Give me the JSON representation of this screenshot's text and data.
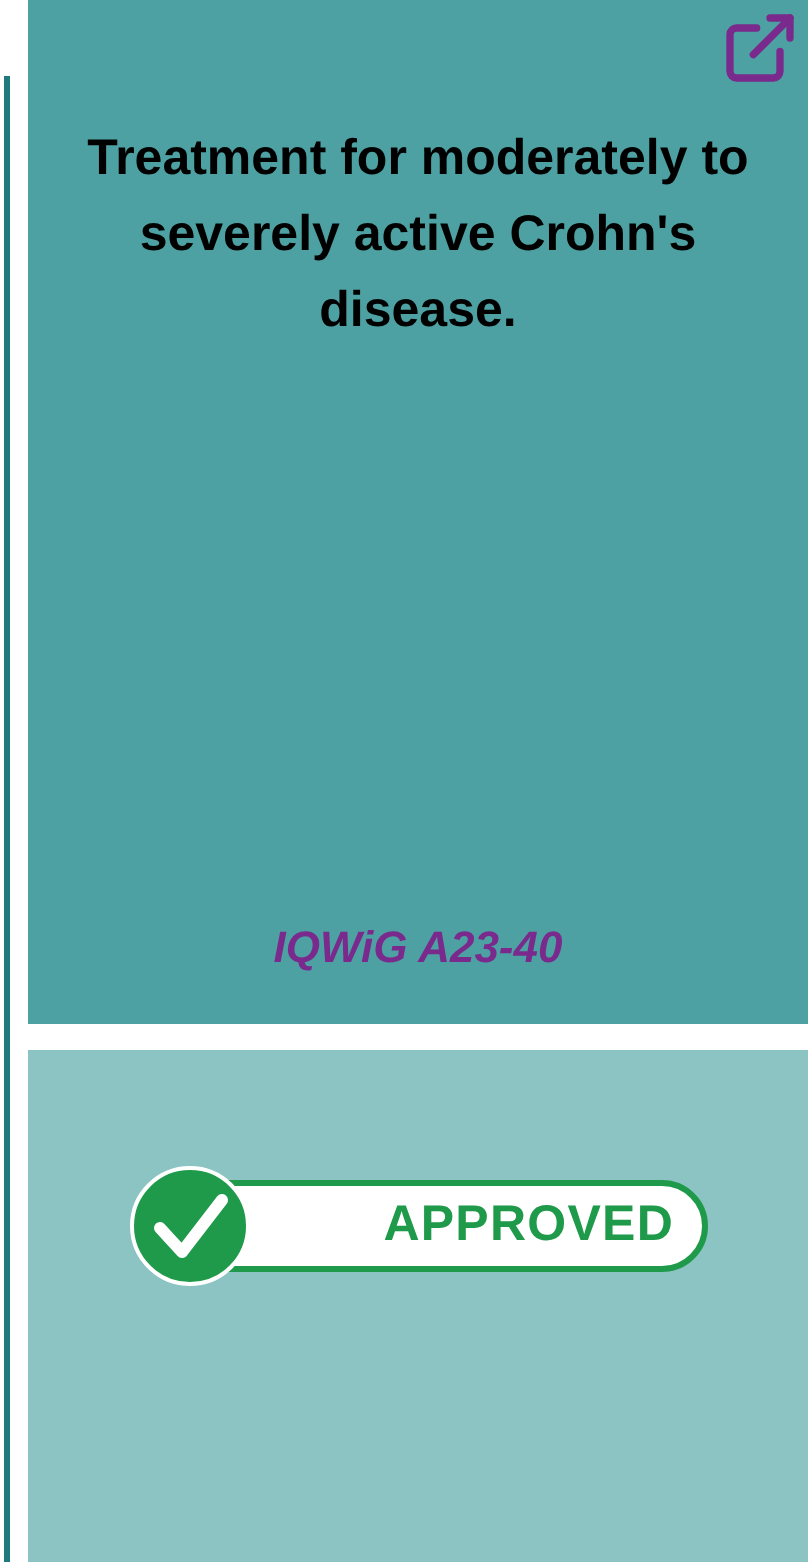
{
  "top_card": {
    "title": "Treatment for moderately to severely active Crohn's disease.",
    "reference": "IQWiG A23-40"
  },
  "bottom_card": {
    "badge": {
      "label": "APPROVED",
      "kind": "approved"
    }
  }
}
